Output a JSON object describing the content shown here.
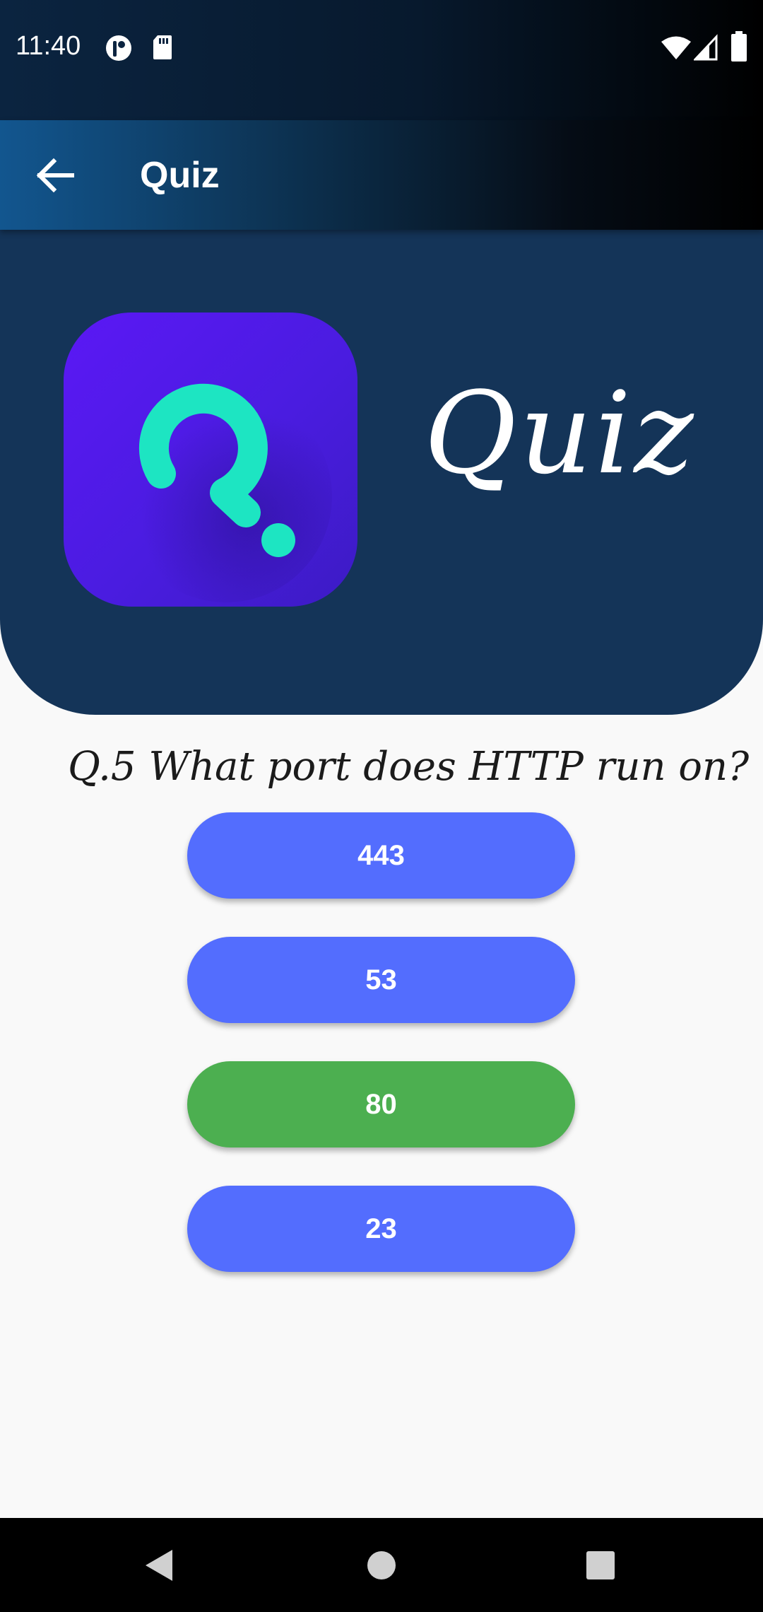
{
  "status_bar": {
    "time": "11:40",
    "left_icons": [
      "app-notification-icon",
      "sd-card-icon"
    ],
    "right_icons": [
      "wifi-icon",
      "signal-icon",
      "battery-icon"
    ]
  },
  "app_bar": {
    "title": "Quiz",
    "back_icon": "arrow-back-icon"
  },
  "header": {
    "brand": "Quiz",
    "logo_icon": "quiz-q-logo-icon"
  },
  "question": {
    "text": "Q.5 What port does HTTP run on?"
  },
  "answers": [
    {
      "label": "443",
      "color": "#536dfe",
      "state": "default"
    },
    {
      "label": "53",
      "color": "#536dfe",
      "state": "default"
    },
    {
      "label": "80",
      "color": "#4caf50",
      "state": "correct"
    },
    {
      "label": "23",
      "color": "#536dfe",
      "state": "default"
    }
  ],
  "nav_bar": {
    "icons": [
      "nav-back-icon",
      "nav-home-icon",
      "nav-recents-icon"
    ]
  },
  "colors": {
    "header_bg": "#143458",
    "answer_default": "#536dfe",
    "answer_correct": "#4caf50",
    "logo_accent": "#1de5c2",
    "logo_bg": "#5b18f5"
  }
}
